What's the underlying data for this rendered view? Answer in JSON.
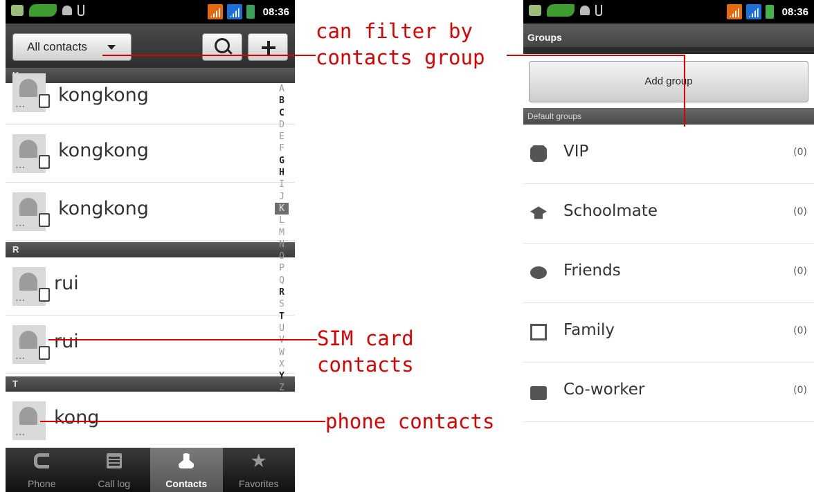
{
  "left_phone": {
    "status": {
      "time": "08:36"
    },
    "toolbar": {
      "filter_label": "All contacts"
    },
    "sections": [
      {
        "letter": "K",
        "contacts": [
          "kongkong",
          "kongkong",
          "kongkong"
        ]
      },
      {
        "letter": "R",
        "contacts": [
          "rui",
          "rui"
        ]
      },
      {
        "letter": "T",
        "contacts": [
          "kong"
        ]
      }
    ],
    "alphabet": [
      "A",
      "B",
      "C",
      "D",
      "E",
      "F",
      "G",
      "H",
      "I",
      "J",
      "K",
      "L",
      "M",
      "N",
      "O",
      "P",
      "Q",
      "R",
      "S",
      "T",
      "U",
      "V",
      "W",
      "X",
      "Y",
      "Z"
    ],
    "alphabet_bold": [
      "B",
      "C",
      "G",
      "H",
      "R",
      "T",
      "Y"
    ],
    "alphabet_selected": "K",
    "tabs": [
      {
        "label": "Phone",
        "icon": "phone-icon"
      },
      {
        "label": "Call log",
        "icon": "call-log-icon"
      },
      {
        "label": "Contacts",
        "icon": "contacts-icon",
        "active": true
      },
      {
        "label": "Favorites",
        "icon": "favorites-star-icon"
      }
    ]
  },
  "right_phone": {
    "status": {
      "time": "08:36"
    },
    "title": "Groups",
    "add_group_label": "Add group",
    "section_label": "Default groups",
    "groups": [
      {
        "name": "VIP",
        "count": "(0)",
        "icon": "vip-badge-icon"
      },
      {
        "name": "Schoolmate",
        "count": "(0)",
        "icon": "graduation-cap-icon"
      },
      {
        "name": "Friends",
        "count": "(0)",
        "icon": "friends-chat-icon"
      },
      {
        "name": "Family",
        "count": "(0)",
        "icon": "family-photo-icon"
      },
      {
        "name": "Co-worker",
        "count": "(0)",
        "icon": "briefcase-icon"
      }
    ]
  },
  "annotations": {
    "filter_note_line1": "can filter by",
    "filter_note_line2": "contacts group",
    "sim_note_line1": "SIM card",
    "sim_note_line2": "contacts",
    "phone_note": "phone contacts"
  },
  "colors": {
    "annotation": "#e00000",
    "active_tab": "#666666"
  }
}
